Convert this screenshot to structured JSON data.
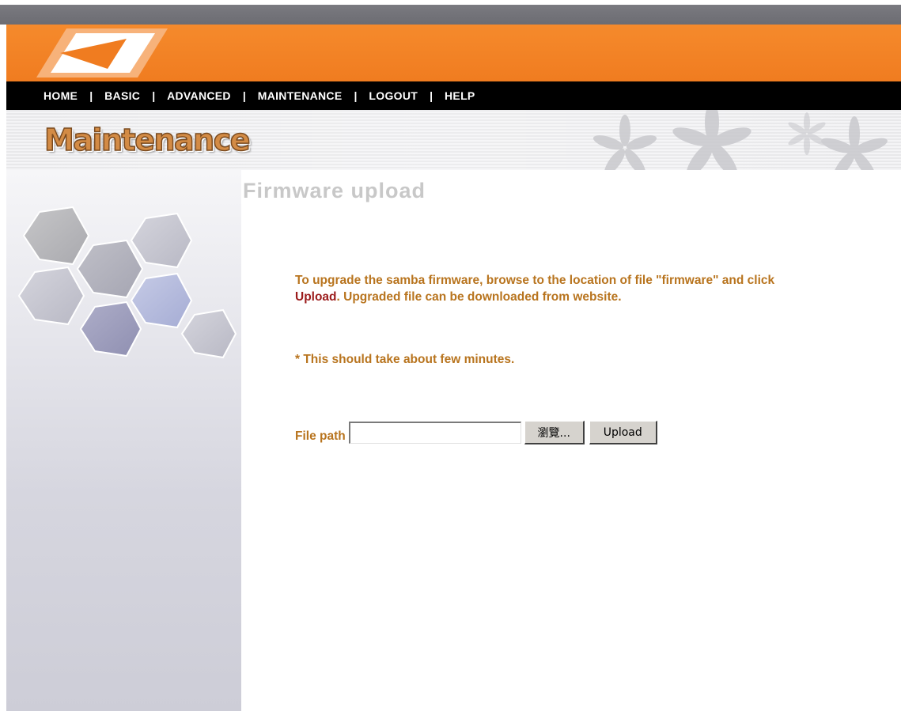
{
  "nav": {
    "items": [
      "HOME",
      "BASIC",
      "ADVANCED",
      "MAINTENANCE",
      "LOGOUT",
      "HELP"
    ],
    "separator": "|"
  },
  "header": {
    "section_title": "Maintenance"
  },
  "main": {
    "heading": "Firmware upload",
    "description_before": "To upgrade the samba firmware, browse to the location of file \"firmware\" and click ",
    "description_highlight": "Upload",
    "description_after": ". Upgraded file can be downloaded from website.",
    "note": "* This should take about few minutes.",
    "file_path_label": "File path",
    "file_path_value": "",
    "browse_label": "瀏覽...",
    "upload_label": "Upload"
  },
  "colors": {
    "orange_bar": "#f58a2c",
    "nav_bg": "#000000",
    "text_accent": "#b8741e",
    "highlight": "#9b1b1b",
    "heading_gray": "#c8c8c8"
  }
}
